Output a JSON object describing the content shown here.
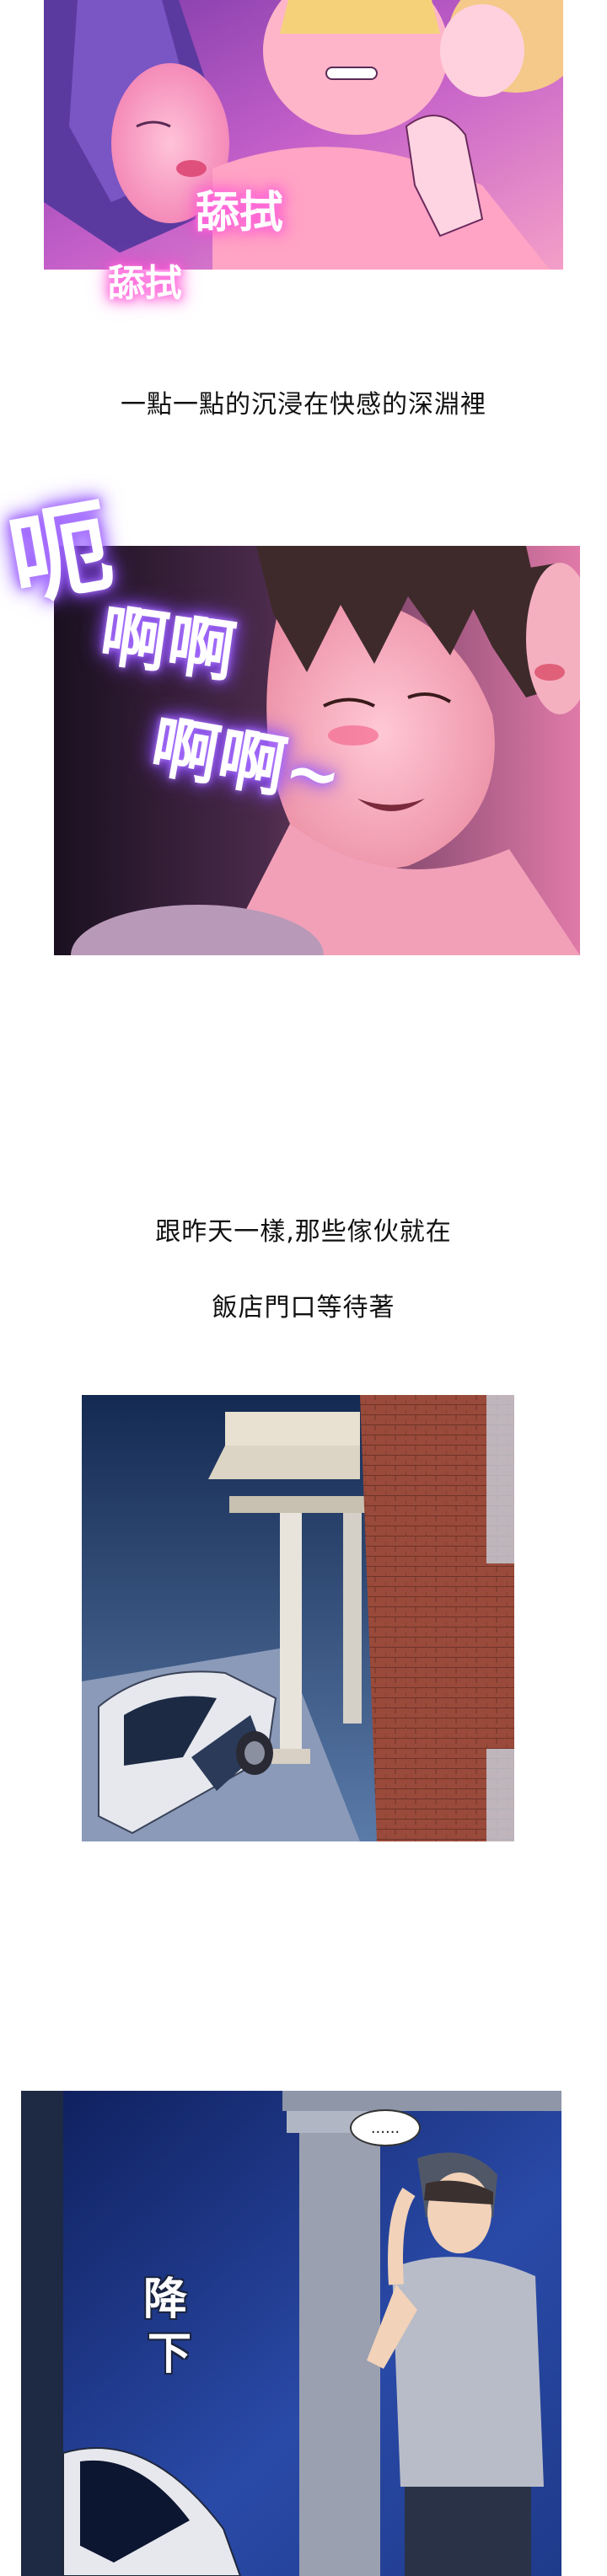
{
  "panels": {
    "panel1": {
      "sfx": [
        "舔拭",
        "舔拭"
      ]
    },
    "caption1": "一點一點的沉浸在快感的深淵裡",
    "panel2": {
      "sfx": [
        "呃",
        "啊啊",
        "啊啊~"
      ]
    },
    "caption2": "跟昨天一樣,那些傢伙就在",
    "caption3": "飯店門口等待著",
    "panel4": {
      "speech": "......",
      "sfx": [
        "降",
        "下"
      ]
    }
  }
}
